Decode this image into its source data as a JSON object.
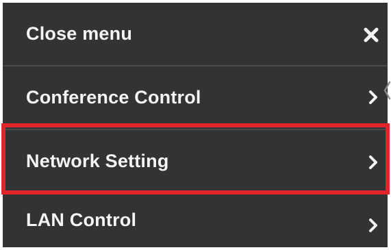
{
  "menu": {
    "items": [
      {
        "label": "Close menu",
        "icon": "close-icon"
      },
      {
        "label": "Conference Control",
        "icon": "chevron-right-icon"
      },
      {
        "label": "Network Setting",
        "icon": "chevron-right-icon",
        "highlighted": true
      },
      {
        "label": "LAN Control",
        "icon": "chevron-right-icon"
      }
    ]
  },
  "colors": {
    "menu_background": "#333333",
    "text": "#f5f5f5",
    "divider": "#4a4a4a",
    "highlight": "#e3232b",
    "page_background": "#ffffff"
  }
}
